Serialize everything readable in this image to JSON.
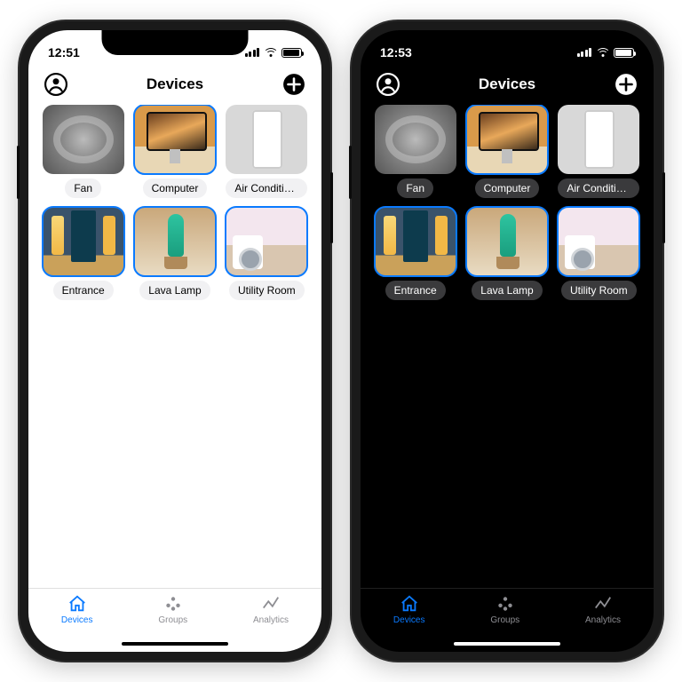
{
  "phones": [
    {
      "theme": "light",
      "time": "12:51"
    },
    {
      "theme": "dark",
      "time": "12:53"
    }
  ],
  "header": {
    "title": "Devices",
    "left_icon": "person-icon",
    "right_icon": "plus-icon"
  },
  "devices": [
    {
      "label": "Fan",
      "thumb": "th-fan",
      "selected": false
    },
    {
      "label": "Computer",
      "thumb": "th-comp",
      "selected": true
    },
    {
      "label": "Air Conditio...",
      "thumb": "th-ac",
      "selected": false
    },
    {
      "label": "Entrance",
      "thumb": "th-ent",
      "selected": true
    },
    {
      "label": "Lava Lamp",
      "thumb": "th-lava",
      "selected": true
    },
    {
      "label": "Utility Room",
      "thumb": "th-util",
      "selected": true
    }
  ],
  "tabs": [
    {
      "label": "Devices",
      "icon": "home-icon",
      "active": true
    },
    {
      "label": "Groups",
      "icon": "groups-icon",
      "active": false
    },
    {
      "label": "Analytics",
      "icon": "analytics-icon",
      "active": false
    }
  ],
  "accent": "#0a7aff"
}
